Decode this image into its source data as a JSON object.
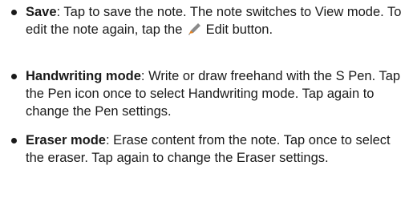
{
  "items": [
    {
      "term": "Save",
      "text_before": ": Tap to save the note. The note switches to View mode. To edit the note again, tap the ",
      "icon": "pencil-icon",
      "text_after": " Edit button."
    },
    {
      "term": "Handwriting mode",
      "text": ": Write or draw freehand with the S Pen. Tap the Pen icon once to select Handwriting mode. Tap again to change the Pen settings."
    },
    {
      "term": "Eraser mode",
      "text": ": Erase content from the note. Tap once to select the eraser. Tap again to change the Eraser settings."
    }
  ],
  "colors": {
    "text": "#1a1a1a",
    "icon_body": "#8a8a8a",
    "icon_tip": "#e8821e"
  }
}
